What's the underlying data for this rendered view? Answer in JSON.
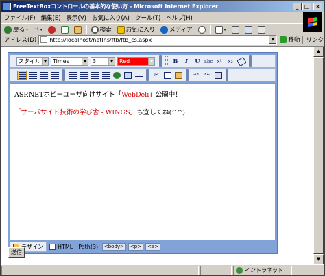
{
  "window": {
    "title": "FreeTextBoxコントロールの基本的な使い方 - Microsoft Internet Explorer",
    "minimize": "_",
    "maximize": "□",
    "close": "×"
  },
  "menubar": {
    "items": [
      "ファイル(F)",
      "編集(E)",
      "表示(V)",
      "お気に入り(A)",
      "ツール(T)",
      "ヘルプ(H)"
    ]
  },
  "toolbar": {
    "back_label": "戻る",
    "search_label": "検索",
    "favorites_label": "お気に入り",
    "media_label": "メディア"
  },
  "addressbar": {
    "label": "アドレス(D)",
    "url": "http://localhost/netIns/ftb/ftb_cs.aspx",
    "go_label": "移動",
    "links_label": "リンク"
  },
  "editor": {
    "style_select": "スタイル",
    "font_select": "Times",
    "size_select": "3",
    "color_select": "Red",
    "line1_prefix": "ASP.NETホビーユーザ向けサイト「",
    "line1_link": "WebDeli",
    "line1_suffix": "」公開中！",
    "line2_link": "「サーバサイド技術の学び舎 - WINGS」",
    "line2_suffix": "も宜しくね(^^)",
    "tabs": {
      "design_label": "デザイン",
      "html_label": "HTML"
    },
    "path_label": "Path(3):",
    "path_tags": [
      "<body>",
      "<p>",
      "<a>"
    ]
  },
  "form": {
    "submit_label": "送信"
  },
  "statusbar": {
    "zone_label": "イントラネット"
  },
  "colors": {
    "titlebar_start": "#0a246a",
    "editor_frame": "#81a3d8",
    "link_red": "#d00000"
  }
}
